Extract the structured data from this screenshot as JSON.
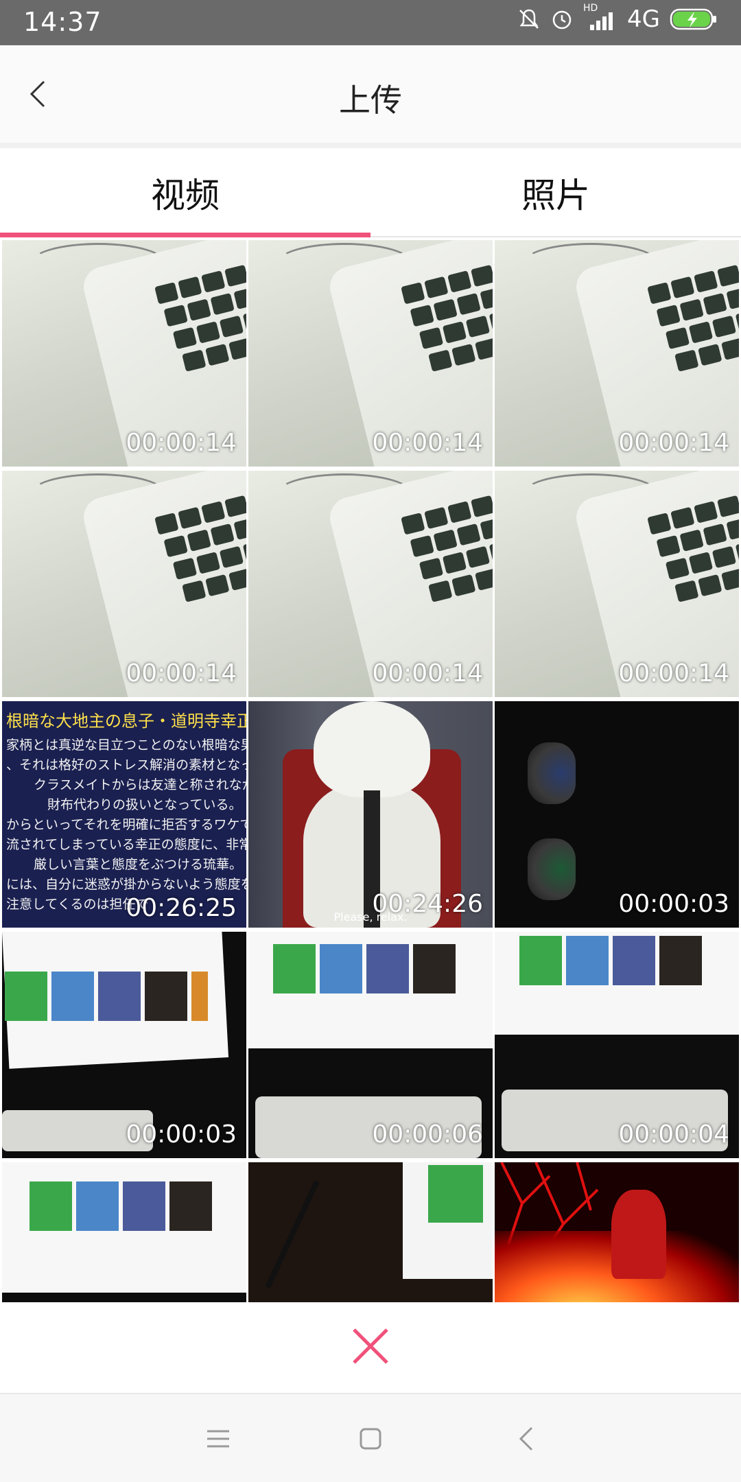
{
  "status_bar": {
    "time": "14:37",
    "icons": [
      "mute-bell-icon",
      "alarm-icon",
      "hd-signal-icon",
      "signal-icon",
      "network-4g",
      "battery-charging-icon"
    ],
    "network": "4G",
    "hd": "HD"
  },
  "header": {
    "title": "上传",
    "back_icon": "chevron-left-icon"
  },
  "tabs": [
    {
      "label": "视频",
      "active": true
    },
    {
      "label": "照片",
      "active": false
    }
  ],
  "accent_color": "#f0517a",
  "videos": [
    {
      "duration": "00:00:14",
      "thumb": "laptop-keyboard"
    },
    {
      "duration": "00:00:14",
      "thumb": "laptop-keyboard"
    },
    {
      "duration": "00:00:14",
      "thumb": "laptop-keyboard"
    },
    {
      "duration": "00:00:14",
      "thumb": "laptop-keyboard"
    },
    {
      "duration": "00:00:14",
      "thumb": "laptop-keyboard"
    },
    {
      "duration": "00:00:14",
      "thumb": "laptop-keyboard"
    },
    {
      "duration": "00:26:25",
      "thumb": "japanese-text",
      "text_lines": [
        "根暗な大地主の息子・道明寺幸正",
        "家柄とは真逆な目立つことのない根暗な男子であ",
        "、それは格好のストレス解消の素材となってしま",
        "クラスメイトからは友達と称されながら",
        "財布代わりの扱いとなっている。",
        "からといってそれを明確に拒否するワケでもなく",
        "流されてしまっている幸正の態度に、非常に苛つい",
        "厳しい言葉と態度をぶつける琉華。",
        "には、自分に迷惑が掛からないよう態度を改めろ",
        "注意してくるのは担任で"
      ]
    },
    {
      "duration": "00:24:26",
      "thumb": "anime-character",
      "subtitle": "Please, relax."
    },
    {
      "duration": "00:00:03",
      "thumb": "dark-lenses"
    },
    {
      "duration": "00:00:03",
      "thumb": "monitor-game-library"
    },
    {
      "duration": "00:00:06",
      "thumb": "monitor-game-library"
    },
    {
      "duration": "00:00:04",
      "thumb": "monitor-game-library"
    },
    {
      "duration": "",
      "thumb": "monitor-game-library"
    },
    {
      "duration": "",
      "thumb": "desk-monitor-dark"
    },
    {
      "duration": "",
      "thumb": "red-night-scene"
    }
  ],
  "cancel": {
    "icon": "close-icon"
  },
  "navbar": {
    "icons": [
      "menu-icon",
      "home-square-icon",
      "back-icon"
    ]
  }
}
